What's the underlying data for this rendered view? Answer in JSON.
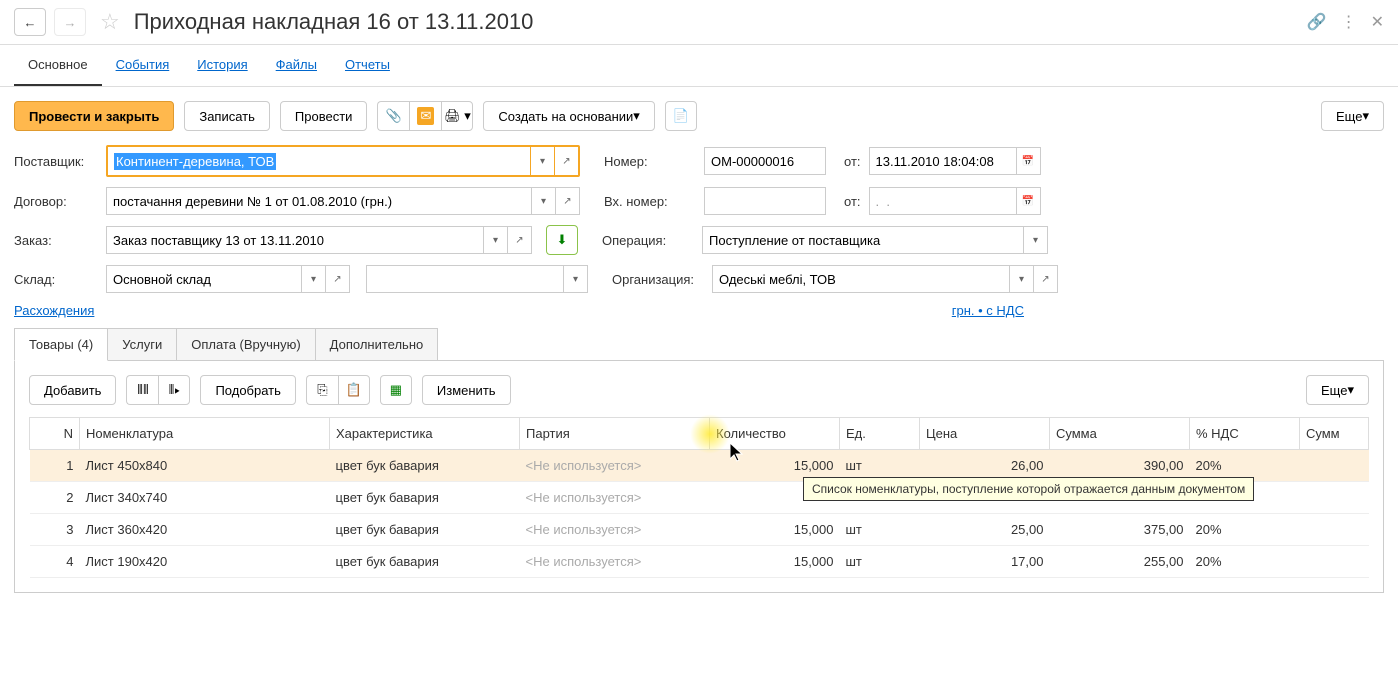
{
  "titlebar": {
    "title": "Приходная накладная 16 от 13.11.2010"
  },
  "nav": {
    "tabs": [
      "Основное",
      "События",
      "История",
      "Файлы",
      "Отчеты"
    ]
  },
  "toolbar": {
    "primary": "Провести и закрыть",
    "save": "Записать",
    "post": "Провести",
    "create_based": "Создать на основании",
    "more": "Еще"
  },
  "form": {
    "supplier_label": "Поставщик:",
    "supplier_value": "Континент-деревина, ТОВ",
    "contract_label": "Договор:",
    "contract_value": "постачання деревини № 1 от 01.08.2010 (грн.)",
    "order_label": "Заказ:",
    "order_value": "Заказ поставщику 13 от 13.11.2010",
    "warehouse_label": "Склад:",
    "warehouse_value": "Основной склад",
    "number_label": "Номер:",
    "number_value": "ОМ-00000016",
    "date_label": "от:",
    "date_value": "13.11.2010 18:04:08",
    "incoming_label": "Вх. номер:",
    "incoming_value": "",
    "incoming_date_label": "от:",
    "incoming_date_value": ".  .",
    "operation_label": "Операция:",
    "operation_value": "Поступление от поставщика",
    "org_label": "Организация:",
    "org_value": "Одеські меблі, ТОВ",
    "discrepancies": "Расхождения",
    "currency_info": "грн. • с НДС"
  },
  "sub_tabs": {
    "items": [
      "Товары (4)",
      "Услуги",
      "Оплата (Вручную)",
      "Дополнительно"
    ]
  },
  "table_toolbar": {
    "add": "Добавить",
    "pick": "Подобрать",
    "change": "Изменить",
    "more": "Еще"
  },
  "table": {
    "headers": {
      "n": "N",
      "nomenclature": "Номенклатура",
      "characteristic": "Характеристика",
      "batch": "Партия",
      "quantity": "Количество",
      "unit": "Ед.",
      "price": "Цена",
      "sum": "Сумма",
      "vat": "% НДС",
      "sum2": "Сумм"
    },
    "batch_placeholder": "<Не используется>",
    "rows": [
      {
        "n": "1",
        "nomenclature": "Лист 450х840",
        "characteristic": "цвет бук бавария",
        "quantity": "15,000",
        "unit": "шт",
        "price": "26,00",
        "sum": "390,00",
        "vat": "20%"
      },
      {
        "n": "2",
        "nomenclature": "Лист 340х740",
        "characteristic": "цвет бук бавария",
        "quantity": "",
        "unit": "",
        "price": "",
        "sum": "",
        "vat": ""
      },
      {
        "n": "3",
        "nomenclature": "Лист 360х420",
        "characteristic": "цвет бук бавария",
        "quantity": "15,000",
        "unit": "шт",
        "price": "25,00",
        "sum": "375,00",
        "vat": "20%"
      },
      {
        "n": "4",
        "nomenclature": "Лист 190х420",
        "characteristic": "цвет бук бавария",
        "quantity": "15,000",
        "unit": "шт",
        "price": "17,00",
        "sum": "255,00",
        "vat": "20%"
      }
    ]
  },
  "tooltip_text": "Список номенклатуры, поступление которой отражается данным документом"
}
